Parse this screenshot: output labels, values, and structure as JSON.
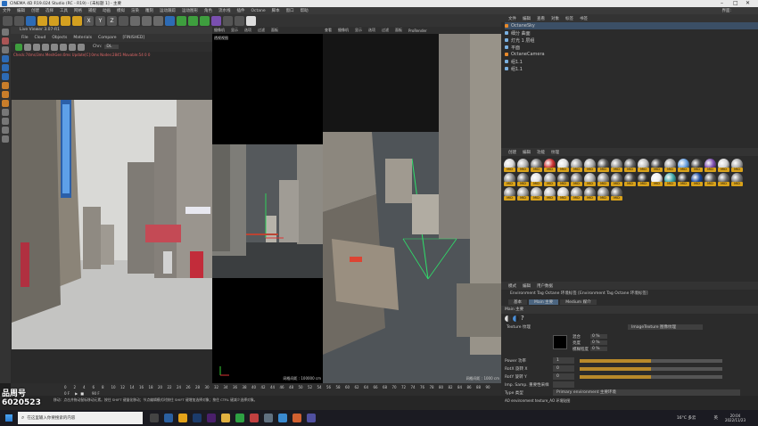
{
  "window": {
    "title": "CINEMA 4D R19.024 Studio (RC - R19) - [未标题 1] - 主要"
  },
  "menubar": {
    "items": [
      "文件",
      "编辑",
      "创建",
      "选择",
      "工具",
      "网格",
      "捕捉",
      "动画",
      "模拟",
      "渲染",
      "雕刻",
      "运动跟踪",
      "运动图形",
      "角色",
      "流水线",
      "插件",
      "Octane",
      "脚本",
      "窗口",
      "帮助"
    ],
    "layout_label": "界面:"
  },
  "live_viewer": {
    "title": "Live Viewer 3.07-R1",
    "menu": [
      "File",
      "Cloud",
      "Objects",
      "Materials",
      "Compare",
      "[FINISHED]"
    ],
    "channel_label": "Chn:",
    "channel_value": "DL",
    "stats": "Check:74ms/3ms MeshGen:0ms Update[C]:0ms Nodes:2845 Movable:54 0 0"
  },
  "viewport_top": {
    "menu": [
      "摄像机",
      "显示",
      "选项",
      "过滤",
      "面板"
    ],
    "label": "透视视图"
  },
  "viewport_center": {
    "menu": [
      "查看",
      "摄像机",
      "显示",
      "选项",
      "过滤",
      "面板"
    ],
    "grid_label": "网格间距 : 100000 cm"
  },
  "viewport_right": {
    "menu": [
      "查看",
      "摄像机",
      "显示",
      "选项",
      "过滤",
      "面板",
      "ProRender"
    ],
    "label": "透视视图",
    "grid_label": "网格间距 : 1000 cm"
  },
  "object_manager": {
    "menu": [
      "文件",
      "编辑",
      "查看",
      "对象",
      "标签",
      "书签"
    ],
    "objects": [
      {
        "name": "OctaneSky",
        "selected": true
      },
      {
        "name": "细分 曲面",
        "selected": false
      },
      {
        "name": "灯光 1 层组",
        "selected": false
      },
      {
        "name": "平面",
        "selected": false
      },
      {
        "name": "OctaneCamera",
        "selected": false
      },
      {
        "name": "组1.1",
        "selected": false
      },
      {
        "name": "组1.1",
        "selected": false
      }
    ]
  },
  "material_manager": {
    "menu": [
      "创建",
      "编辑",
      "功能",
      "纹理"
    ],
    "tag": "MID",
    "swatch_count": 60
  },
  "attributes": {
    "menu": [
      "模式",
      "编辑",
      "用户数据"
    ],
    "header": "Environment Tag Octane 环境标签 [Environment Tag Octane 环境标签]",
    "tabs": [
      "基本",
      "Main 主要",
      "Medium 媒介"
    ],
    "section": "Main 主要",
    "texture_label": "Texture 纹理",
    "texture_value": "ImageTexture 图像纹理",
    "rows": [
      {
        "label": "Power 功率",
        "value": "1"
      },
      {
        "label": "RotX 旋转 X",
        "value": "0"
      },
      {
        "label": "RotY 旋转 Y",
        "value": "0"
      },
      {
        "label": "Imp. Samp. 重要性采样",
        "value": ""
      },
      {
        "label": "Type 类型",
        "value": "Primary environment 主要环境"
      }
    ],
    "sub_labels": [
      "混合",
      "亮度",
      "模糊程度"
    ],
    "sub_values": [
      "0 %",
      "0 %",
      "0 %"
    ]
  },
  "timeline": {
    "ticks": [
      "0",
      "2",
      "4",
      "6",
      "8",
      "10",
      "12",
      "14",
      "16",
      "18",
      "20",
      "22",
      "24",
      "26",
      "28",
      "30",
      "32",
      "34",
      "36",
      "38",
      "40",
      "42",
      "44",
      "46",
      "48",
      "50",
      "52",
      "54",
      "56",
      "58",
      "60",
      "62",
      "64",
      "66",
      "68",
      "70",
      "72",
      "74",
      "76",
      "78",
      "80",
      "82",
      "84",
      "86",
      "88",
      "90"
    ],
    "frame_start": "0 F",
    "frame_end": "90 F"
  },
  "status_bar": {
    "text": "移动：点击并拖动鼠标移动元素。按住 SHIFT 键量化移动；节点编辑模式时按住 SHIFT 键增加选择对象；按住 CTRL 键减少选择对象。",
    "tag_text": "AO environment texture_AO 环境贴图"
  },
  "watermark": {
    "brand": "品周号",
    "id": "6020523"
  },
  "taskbar": {
    "search_placeholder": "在这里输入你要搜索的内容",
    "weather": "16°C 多云",
    "time": "20:04",
    "date": "2022/11/23",
    "lang": "英"
  },
  "colors": {
    "accent": "#3b4f66",
    "material_tag": "#d9a21a",
    "octane_orange": "#e8892b"
  }
}
